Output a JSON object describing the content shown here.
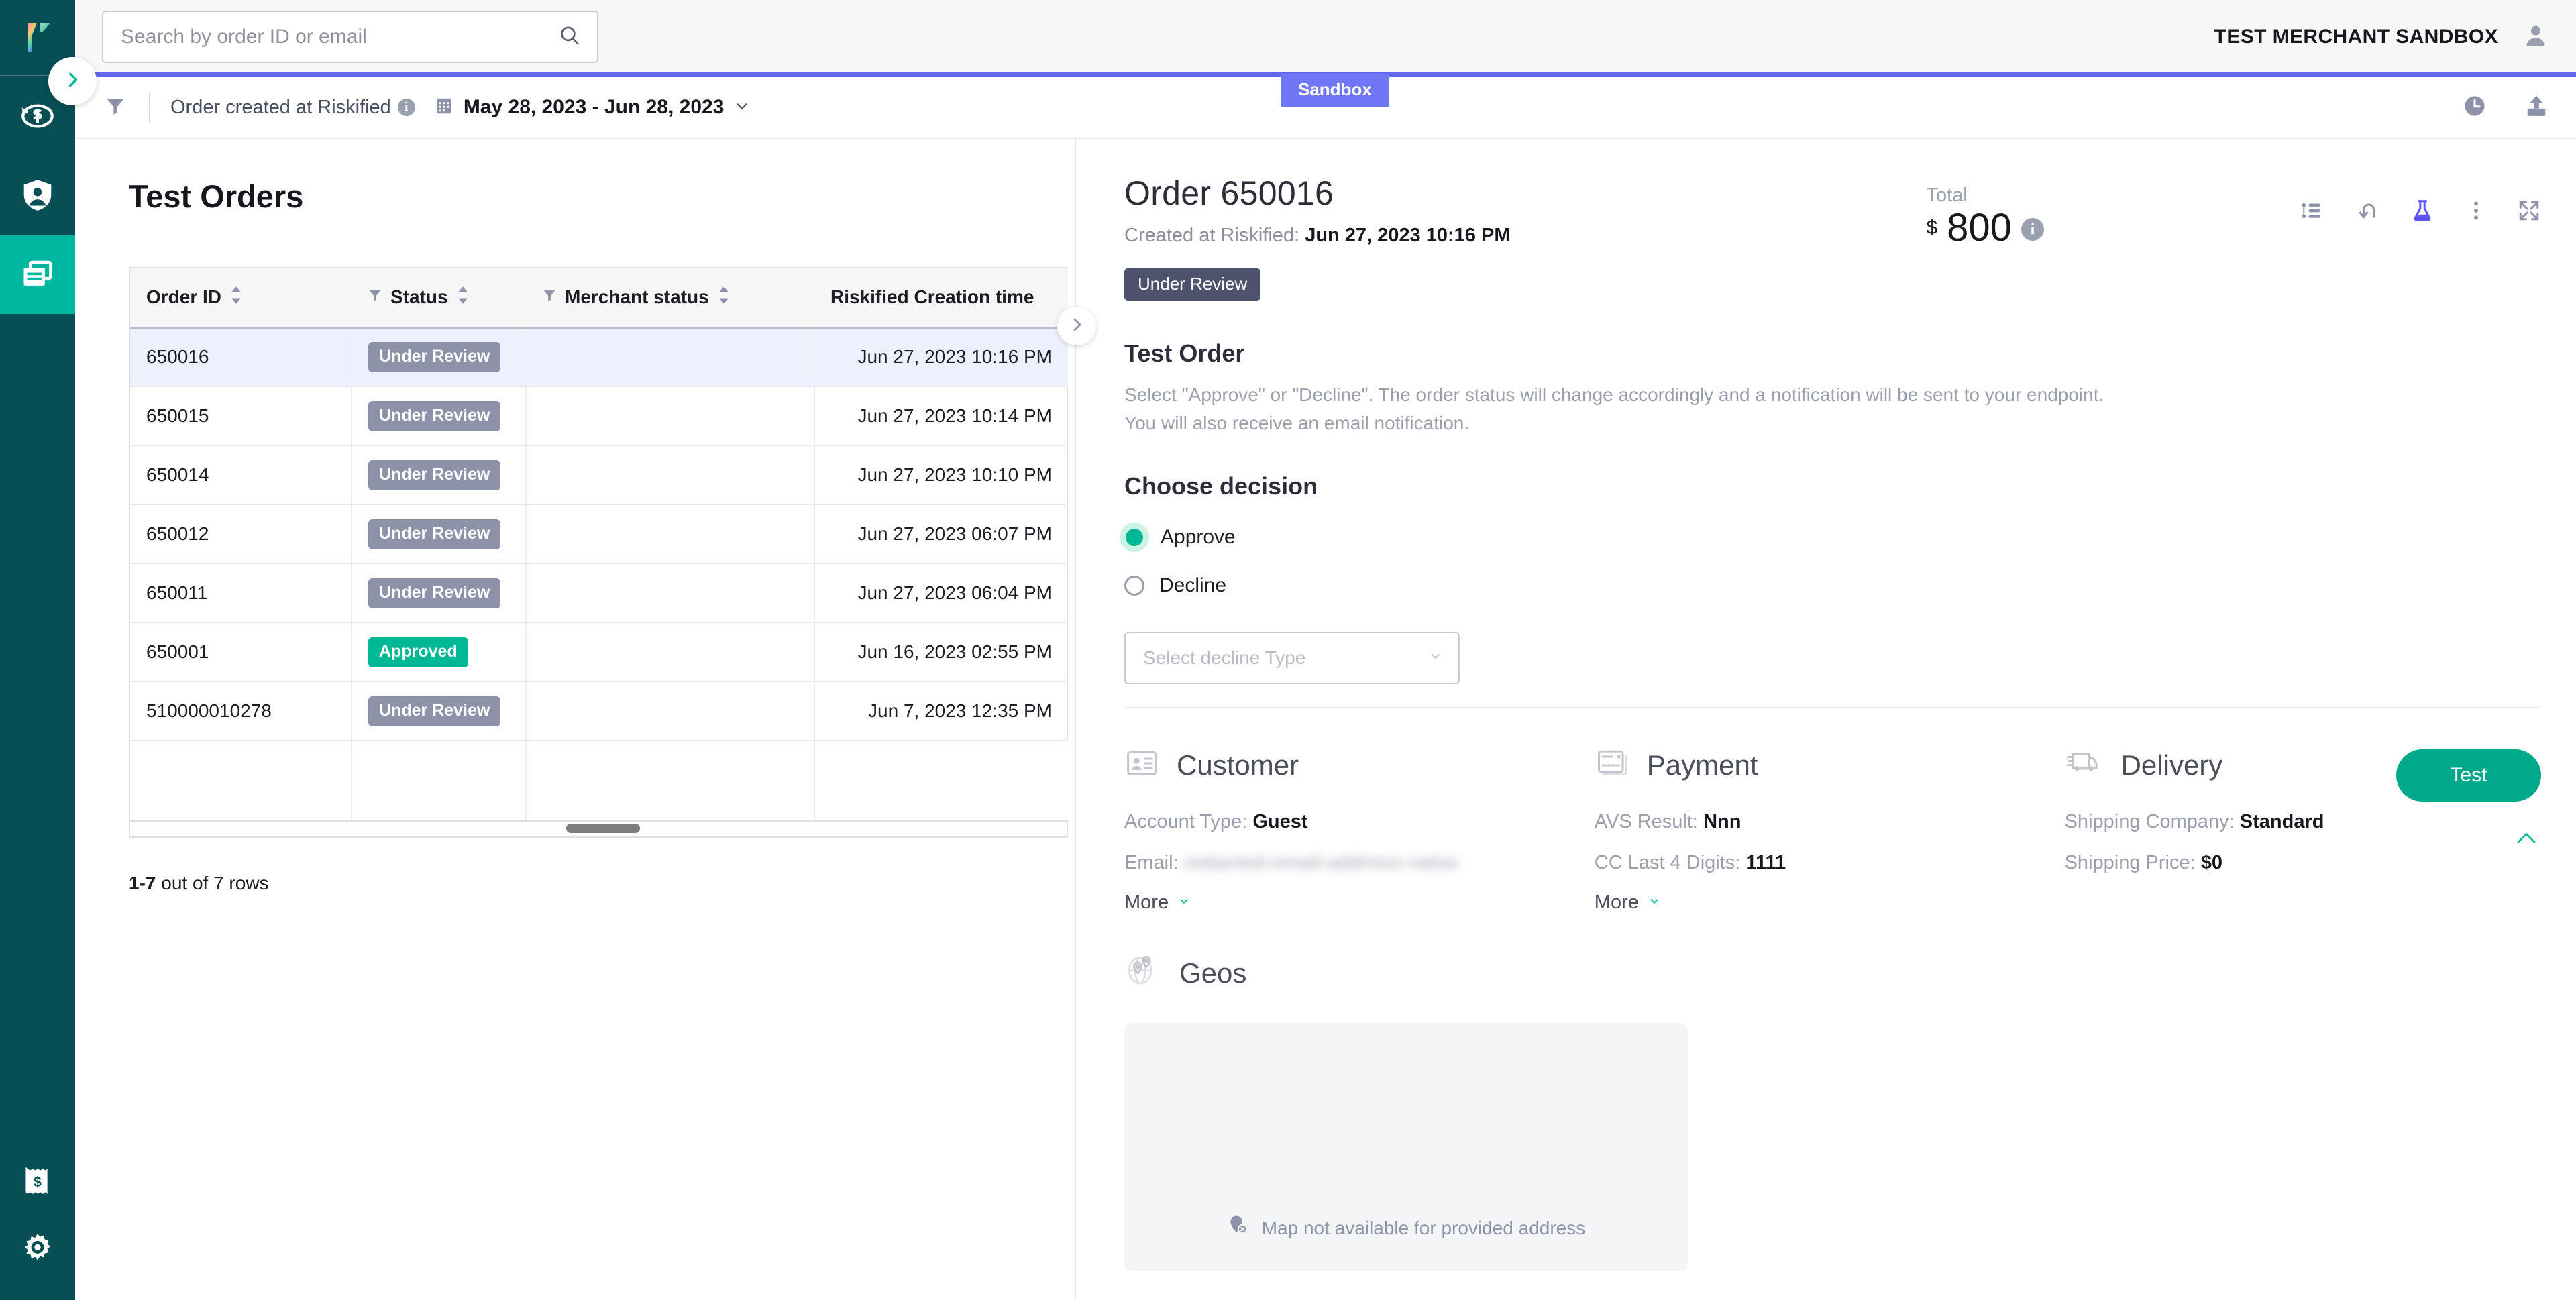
{
  "sidebar": {
    "logo_name": "riskified-logo",
    "expand_label": "expand-sidebar",
    "items": [
      {
        "name": "chargebacks",
        "icon": "dollar-refresh-icon",
        "active": false
      },
      {
        "name": "account-protection",
        "icon": "shield-user-icon",
        "active": false
      },
      {
        "name": "orders",
        "icon": "orders-list-icon",
        "active": true
      },
      {
        "name": "billing",
        "icon": "receipt-dollar-icon",
        "active": false
      },
      {
        "name": "settings",
        "icon": "gear-icon",
        "active": false
      }
    ]
  },
  "header": {
    "search_placeholder": "Search by order ID or email",
    "search_value": "",
    "search_icon": "search-icon",
    "merchant_name": "TEST MERCHANT SANDBOX",
    "avatar_icon": "user-avatar-icon",
    "sandbox_badge": "Sandbox"
  },
  "filterbar": {
    "filter_icon": "funnel-icon",
    "filter_label": "Order created at Riskified",
    "info_icon": "info-icon",
    "info_glyph": "i",
    "calendar_icon": "calendar-icon",
    "date_range": "May 28, 2023 - Jun 28, 2023",
    "chevron_icon": "chevron-down-icon",
    "history_icon": "clock-history-icon",
    "export_icon": "upload-export-icon"
  },
  "list_pane": {
    "title": "Test Orders",
    "columns": [
      {
        "label": "Order ID",
        "filterable": false,
        "sortable": true
      },
      {
        "label": "Status",
        "filterable": true,
        "sortable": true
      },
      {
        "label": "Merchant status",
        "filterable": true,
        "sortable": true
      },
      {
        "label": "Riskified Creation time",
        "filterable": false,
        "sortable": false
      }
    ],
    "rows": [
      {
        "order_id": "650016",
        "status": "Under Review",
        "status_kind": "review",
        "merchant_status": "",
        "creation_time": "Jun 27, 2023 10:16 PM",
        "selected": true
      },
      {
        "order_id": "650015",
        "status": "Under Review",
        "status_kind": "review",
        "merchant_status": "",
        "creation_time": "Jun 27, 2023 10:14 PM",
        "selected": false
      },
      {
        "order_id": "650014",
        "status": "Under Review",
        "status_kind": "review",
        "merchant_status": "",
        "creation_time": "Jun 27, 2023 10:10 PM",
        "selected": false
      },
      {
        "order_id": "650012",
        "status": "Under Review",
        "status_kind": "review",
        "merchant_status": "",
        "creation_time": "Jun 27, 2023 06:07 PM",
        "selected": false
      },
      {
        "order_id": "650011",
        "status": "Under Review",
        "status_kind": "review",
        "merchant_status": "",
        "creation_time": "Jun 27, 2023 06:04 PM",
        "selected": false
      },
      {
        "order_id": "650001",
        "status": "Approved",
        "status_kind": "approved",
        "merchant_status": "",
        "creation_time": "Jun 16, 2023 02:55 PM",
        "selected": false
      },
      {
        "order_id": "510000010278",
        "status": "Under Review",
        "status_kind": "review",
        "merchant_status": "",
        "creation_time": "Jun 7, 2023 12:35 PM",
        "selected": false
      }
    ],
    "rows_count_bold": "1-7",
    "rows_count_rest": " out of 7 rows"
  },
  "detail": {
    "title": "Order 650016",
    "created_label": "Created at Riskified:",
    "created_value": "Jun 27, 2023 10:16 PM",
    "status_badge": "Under Review",
    "total_label": "Total",
    "currency": "$",
    "total_amount": "800",
    "total_info_glyph": "i",
    "actions": [
      {
        "name": "timeline-icon"
      },
      {
        "name": "undo-arrow-icon"
      },
      {
        "name": "flask-test-icon"
      },
      {
        "name": "more-vertical-icon"
      },
      {
        "name": "expand-icon"
      }
    ],
    "test_order": {
      "title": "Test Order",
      "description": "Select \"Approve\" or \"Decline\". The order status will change accordingly and a notification will be sent to your endpoint. You will also receive an email notification.",
      "choose_label": "Choose decision",
      "option_approve": "Approve",
      "option_decline": "Decline",
      "selected_option": "Approve",
      "decline_placeholder": "Select decline Type",
      "test_button": "Test",
      "collapse_icon": "chevron-up-icon"
    },
    "customer": {
      "icon": "id-card-icon",
      "title": "Customer",
      "account_type_label": "Account Type:",
      "account_type_value": "Guest",
      "email_label": "Email:",
      "email_value_redacted": "redacted-email-address-value",
      "more_label": "More",
      "more_icon": "chevron-down-icon"
    },
    "payment": {
      "icon": "credit-card-icon",
      "title": "Payment",
      "avs_label": "AVS Result:",
      "avs_value": "Nnn",
      "cc_label": "CC Last 4 Digits:",
      "cc_value": "1111",
      "more_label": "More",
      "more_icon": "chevron-down-icon"
    },
    "delivery": {
      "icon": "delivery-truck-icon",
      "title": "Delivery",
      "company_label": "Shipping Company:",
      "company_value": "Standard",
      "price_label": "Shipping Price:",
      "price_value": "$0"
    },
    "geos": {
      "icon": "globe-pins-icon",
      "title": "Geos",
      "map_unavailable_icon": "map-pin-error-icon",
      "map_unavailable_text": "Map not available for provided address"
    }
  },
  "colors": {
    "rail_bg": "#074e55",
    "rail_active": "#00b8a0",
    "accent_green": "#00b894",
    "accent_purple": "#6366f1",
    "status_review": "#8d92a8",
    "status_badge_dark": "#4e536d",
    "selected_row": "#eef1fd"
  }
}
